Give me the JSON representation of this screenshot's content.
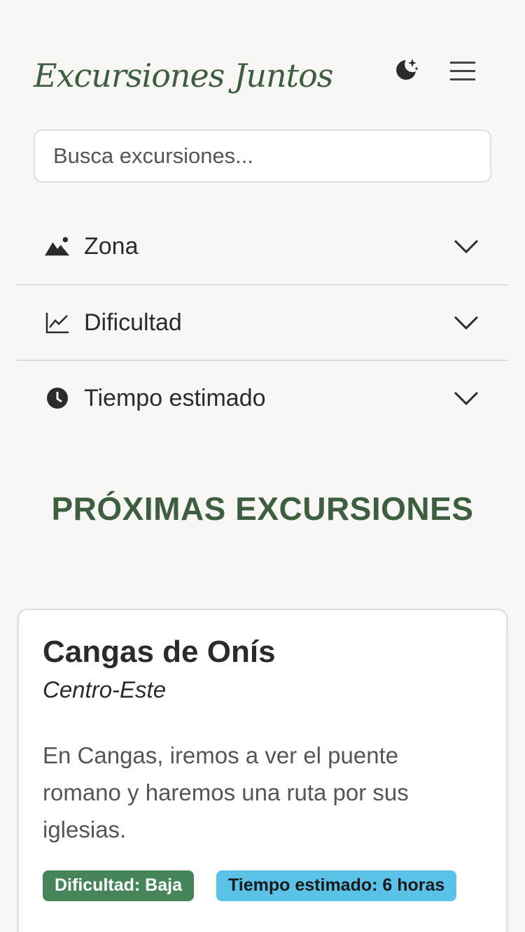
{
  "header": {
    "logo_text": "Excursiones Juntos",
    "theme_toggle_icon": "moon-stars-icon",
    "menu_icon": "hamburger-menu-icon"
  },
  "search": {
    "placeholder": "Busca excursiones...",
    "value": ""
  },
  "filters": [
    {
      "label": "Zona",
      "icon": "mountains-icon"
    },
    {
      "label": "Dificultad",
      "icon": "line-chart-icon"
    },
    {
      "label": "Tiempo estimado",
      "icon": "clock-icon"
    }
  ],
  "section": {
    "title": "PRÓXIMAS EXCURSIONES"
  },
  "excursions": [
    {
      "title": "Cangas de Onís",
      "zone": "Centro-Este",
      "description": "En Cangas, iremos a ver el puente romano y haremos una ruta por sus iglesias.",
      "difficulty_badge": "Dificultad: Baja",
      "time_badge": "Tiempo estimado: 6 horas"
    }
  ],
  "colors": {
    "brand_green": "#3e5e40",
    "difficulty_badge": "#468559",
    "time_badge": "#5bc2e7",
    "background": "#f8f7f5"
  }
}
